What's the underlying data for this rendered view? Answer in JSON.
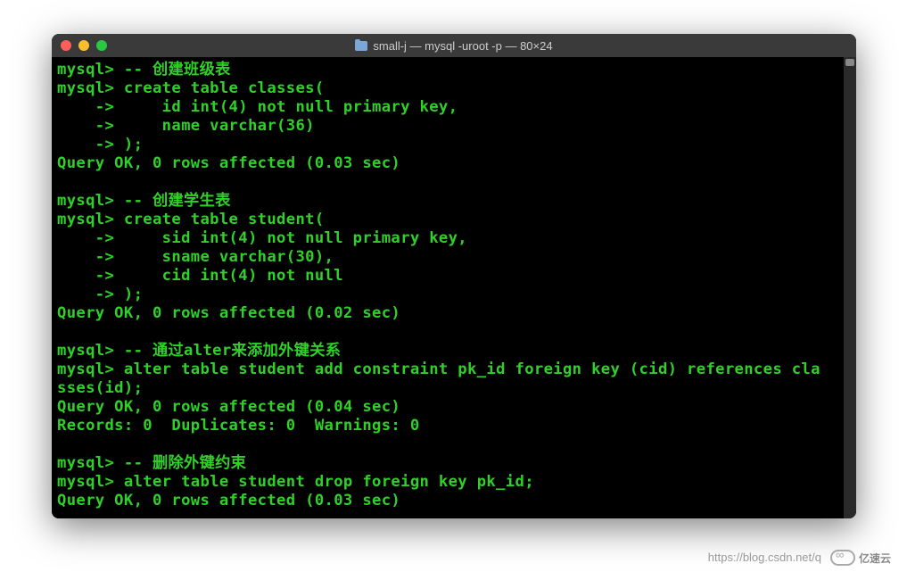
{
  "window": {
    "title": "small-j — mysql -uroot -p — 80×24"
  },
  "terminal": {
    "lines": [
      "mysql> -- 创建班级表",
      "mysql> create table classes(",
      "    ->     id int(4) not null primary key,",
      "    ->     name varchar(36)",
      "    -> );",
      "Query OK, 0 rows affected (0.03 sec)",
      "",
      "mysql> -- 创建学生表",
      "mysql> create table student(",
      "    ->     sid int(4) not null primary key,",
      "    ->     sname varchar(30),",
      "    ->     cid int(4) not null",
      "    -> );",
      "Query OK, 0 rows affected (0.02 sec)",
      "",
      "mysql> -- 通过alter来添加外键关系",
      "mysql> alter table student add constraint pk_id foreign key (cid) references cla",
      "sses(id);",
      "Query OK, 0 rows affected (0.04 sec)",
      "Records: 0  Duplicates: 0  Warnings: 0",
      "",
      "mysql> -- 删除外键约束",
      "mysql> alter table student drop foreign key pk_id;",
      "Query OK, 0 rows affected (0.03 sec)"
    ]
  },
  "watermark": {
    "url": "https://blog.csdn.net/q",
    "brand": "亿速云"
  }
}
